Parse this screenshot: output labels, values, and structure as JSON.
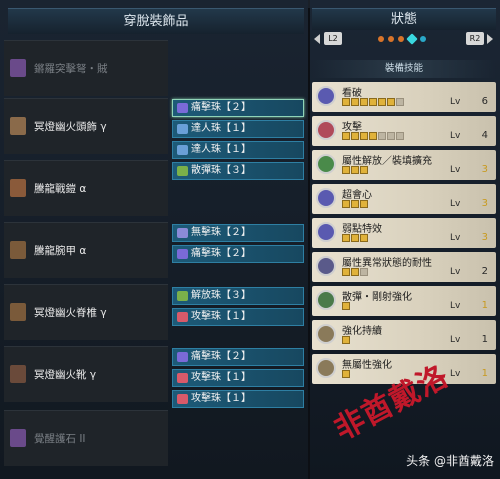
{
  "left": {
    "title": "穿脫裝飾品"
  },
  "right": {
    "title": "狀態",
    "l_button": "L2",
    "r_button": "R2",
    "skills_title": "裝備技能"
  },
  "equipment": [
    {
      "name": "鏘羅突擊弩・賊",
      "icon": "crossbow-icon",
      "icon_color": "#6a4a8a",
      "dim": true
    },
    {
      "name": "冥燈幽火頭飾 γ",
      "icon": "helmet-icon",
      "icon_color": "#8a6a4a",
      "dim": false
    },
    {
      "name": "騰龍戰鎧 α",
      "icon": "chest-armor-icon",
      "icon_color": "#8a5a3a",
      "dim": false
    },
    {
      "name": "騰龍腕甲 α",
      "icon": "arm-armor-icon",
      "icon_color": "#7a5a3a",
      "dim": false
    },
    {
      "name": "冥燈幽火脊椎 γ",
      "icon": "waist-armor-icon",
      "icon_color": "#7a5a3a",
      "dim": false
    },
    {
      "name": "冥燈幽火靴 γ",
      "icon": "leg-armor-icon",
      "icon_color": "#6a4a3a",
      "dim": false
    },
    {
      "name": "覺醒護石 II",
      "icon": "charm-icon",
      "icon_color": "#6a4a8a",
      "dim": true
    }
  ],
  "slots": [
    {
      "label": "痛擊珠【２】",
      "gem_color": "#7a6ad8",
      "selected": true
    },
    {
      "label": "達人珠【１】",
      "gem_color": "#6aa0d8",
      "selected": false
    },
    {
      "label": "達人珠【１】",
      "gem_color": "#6aa0d8",
      "selected": false
    },
    {
      "label": "散彈珠【３】",
      "gem_color": "#7ab04a",
      "selected": false
    },
    {
      "label": "無擊珠【２】",
      "gem_color": "#8a8ad8",
      "selected": false
    },
    {
      "label": "痛擊珠【２】",
      "gem_color": "#7a6ad8",
      "selected": false
    },
    {
      "label": "解放珠【３】",
      "gem_color": "#7ab04a",
      "selected": false
    },
    {
      "label": "攻擊珠【１】",
      "gem_color": "#d85a6a",
      "selected": false
    },
    {
      "label": "痛擊珠【２】",
      "gem_color": "#7a6ad8",
      "selected": false
    },
    {
      "label": "攻擊珠【１】",
      "gem_color": "#d85a6a",
      "selected": false
    },
    {
      "label": "攻擊珠【１】",
      "gem_color": "#d85a6a",
      "selected": false
    }
  ],
  "skills": [
    {
      "name": "看破",
      "icon": "eye-icon",
      "icon_color": "#5a5ab0",
      "filled": 6,
      "total": 7,
      "lv_label": "Lv",
      "level": "6",
      "gold": false
    },
    {
      "name": "攻擊",
      "icon": "sword-icon",
      "icon_color": "#b04a5a",
      "filled": 4,
      "total": 7,
      "lv_label": "Lv",
      "level": "4",
      "gold": false
    },
    {
      "name": "屬性解放／裝填擴充",
      "icon": "unlock-icon",
      "icon_color": "#4a8a4a",
      "filled": 3,
      "total": 3,
      "lv_label": "Lv",
      "level": "3",
      "gold": true
    },
    {
      "name": "超會心",
      "icon": "crit-icon",
      "icon_color": "#5a5ab0",
      "filled": 3,
      "total": 3,
      "lv_label": "Lv",
      "level": "3",
      "gold": true
    },
    {
      "name": "弱點特效",
      "icon": "weakness-icon",
      "icon_color": "#5a5ab0",
      "filled": 3,
      "total": 3,
      "lv_label": "Lv",
      "level": "3",
      "gold": true
    },
    {
      "name": "屬性異常狀態的耐性",
      "icon": "status-resist-icon",
      "icon_color": "#5a5a8a",
      "filled": 2,
      "total": 3,
      "lv_label": "Lv",
      "level": "2",
      "gold": false
    },
    {
      "name": "散彈・剛射強化",
      "icon": "spread-shot-icon",
      "icon_color": "#4a7a4a",
      "filled": 1,
      "total": 1,
      "lv_label": "Lv",
      "level": "1",
      "gold": true
    },
    {
      "name": "強化持續",
      "icon": "hourglass-icon",
      "icon_color": "#8a7a5a",
      "filled": 1,
      "total": 1,
      "lv_label": "Lv",
      "level": "1",
      "gold": false
    },
    {
      "name": "無屬性強化",
      "icon": "raw-boost-icon",
      "icon_color": "#8a7a5a",
      "filled": 1,
      "total": 1,
      "lv_label": "Lv",
      "level": "1",
      "gold": true
    }
  ],
  "watermark": "非酋戴洛",
  "credit": "头条 @非酋戴洛"
}
